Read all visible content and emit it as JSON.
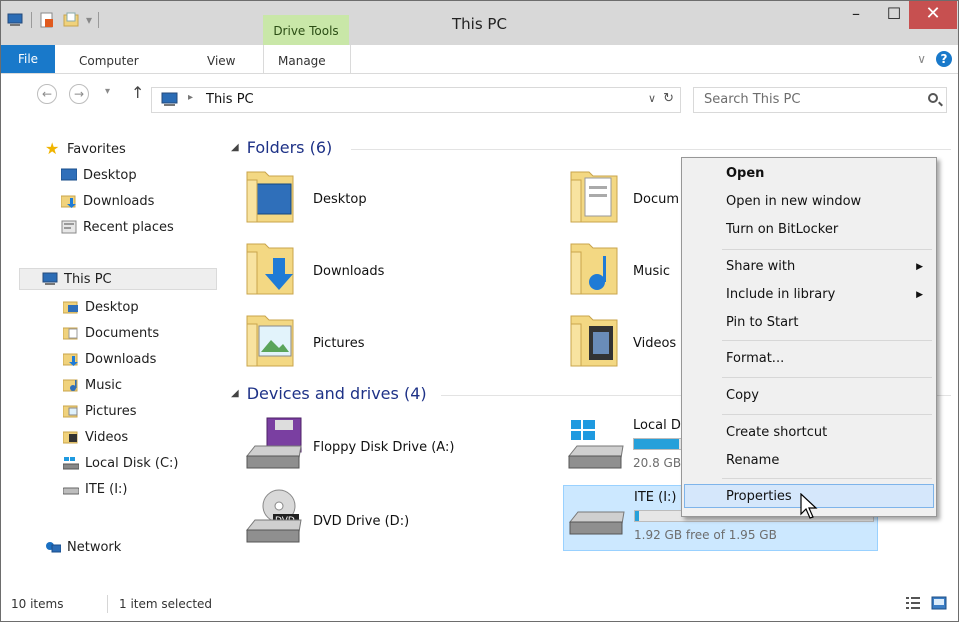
{
  "window": {
    "title": "This PC",
    "contextual_tab_group": "Drive Tools",
    "minimize_glyph": "–",
    "maximize_glyph": "☐",
    "close_glyph": "✕"
  },
  "ribbon": {
    "tabs": [
      "File",
      "Computer",
      "View",
      "Manage"
    ],
    "collapse_glyph": "∨",
    "help_glyph": "?"
  },
  "address_bar": {
    "path": "This PC",
    "search_placeholder": "Search This PC"
  },
  "nav_pane": {
    "favorites_label": "Favorites",
    "favorites": [
      "Desktop",
      "Downloads",
      "Recent places"
    ],
    "this_pc_label": "This PC",
    "this_pc_items": [
      "Desktop",
      "Documents",
      "Downloads",
      "Music",
      "Pictures",
      "Videos",
      "Local Disk (C:)",
      "ITE (I:)"
    ],
    "network_label": "Network"
  },
  "content": {
    "folders_header": "Folders (6)",
    "folders": [
      "Desktop",
      "Documents",
      "Downloads",
      "Music",
      "Pictures",
      "Videos"
    ],
    "folders_visible": [
      "Desktop",
      "Docum",
      "Downloads",
      "Music",
      "Pictures",
      "Videos"
    ],
    "devices_header": "Devices and drives (4)",
    "drives": [
      {
        "name": "Floppy Disk Drive (A:)"
      },
      {
        "name": "Local D",
        "free_text": "20.8 GB",
        "used_fraction": 0.78
      },
      {
        "name": "DVD Drive (D:)"
      },
      {
        "name": "ITE (I:)",
        "free_text": "1.92 GB free of 1.95 GB",
        "used_fraction": 0.015
      }
    ]
  },
  "context_menu": {
    "items": [
      "Open",
      "Open in new window",
      "Turn on BitLocker",
      "Share with",
      "Include in library",
      "Pin to Start",
      "Format...",
      "Copy",
      "Create shortcut",
      "Rename",
      "Properties"
    ],
    "highlighted": "Properties"
  },
  "status_bar": {
    "item_count": "10 items",
    "selection": "1 item selected"
  },
  "colors": {
    "file_tab": "#1979ca",
    "drive_tools": "#c9e7a8",
    "close_button": "#c75050",
    "group_header": "#1e3287",
    "selection": "#cce8ff",
    "bar_fill": "#26a0da"
  }
}
